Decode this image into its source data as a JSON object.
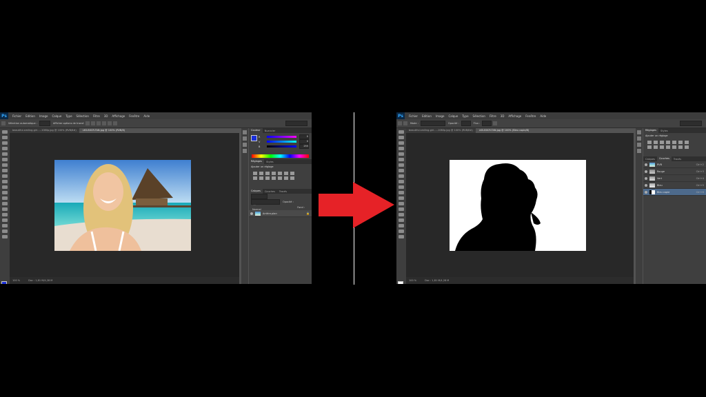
{
  "left_window": {
    "app_logo": "Ps",
    "menu": [
      "Fichier",
      "Edition",
      "Image",
      "Calque",
      "Type",
      "Sélection",
      "Filtre",
      "3D",
      "Affichage",
      "Fenêtre",
      "Aide"
    ],
    "options": {
      "label1": "Sélection automatique :",
      "label2": "Calque",
      "label3": "Afficher options de transf.",
      "workspace": "Essentiel"
    },
    "tabs": [
      "beautiful-smiling-girl-...-1080p.jpg @ 100% (RVB/8#)",
      "LKS-B0CR-TAN.jpg @ 100% (RVB/8)"
    ],
    "status": {
      "zoom": "100 %",
      "doc": "Doc : 1,81 M/4,28 M"
    },
    "color_panel": {
      "tabs": [
        "Couleur",
        "Nuancier"
      ],
      "channels": [
        {
          "label": "R",
          "value": "0"
        },
        {
          "label": "V",
          "value": "0"
        },
        {
          "label": "B",
          "value": "255"
        }
      ]
    },
    "adjustments_panel": {
      "tabs": [
        "Réglages",
        "Styles"
      ],
      "title": "Ajouter un réglage"
    },
    "layers_panel": {
      "tabs": [
        "Calques",
        "Couches",
        "Tracés"
      ],
      "filter": "Type",
      "blend": "Normal",
      "opacity_label": "Opacité :",
      "fill_label": "Fond :",
      "layers": [
        {
          "name": "Arrière-plan",
          "value": ""
        }
      ]
    }
  },
  "arrow_color": "#e62227",
  "right_window": {
    "app_logo": "Ps",
    "menu": [
      "Fichier",
      "Edition",
      "Image",
      "Calque",
      "Type",
      "Sélection",
      "Filtre",
      "3D",
      "Affichage",
      "Fenêtre",
      "Aide"
    ],
    "options": {
      "mode_label": "Mode :",
      "mode_value": "Normal",
      "opacity_label": "Opacité :",
      "opacity_value": "100%",
      "flow_label": "Flux :",
      "flow_value": "100%",
      "workspace": "Essentiel"
    },
    "tabs": [
      "beautiful-smiling-girl-...-1080p.jpg @ 100% (RVB/8#)",
      "LKS-B0CR-TAN.jpg @ 100% (Bleu copie/8)"
    ],
    "status": {
      "zoom": "100 %",
      "doc": "Doc : 1,81 M/4,28 M"
    },
    "adjustments_panel": {
      "tabs": [
        "Réglages",
        "Styles"
      ],
      "title": "Ajouter un réglage"
    },
    "channels_panel": {
      "tabs": [
        "Calques",
        "Couches",
        "Tracés"
      ],
      "channels": [
        {
          "name": "RVB",
          "shortcut": "Ctrl+2"
        },
        {
          "name": "Rouge",
          "shortcut": "Ctrl+3"
        },
        {
          "name": "Vert",
          "shortcut": "Ctrl+4"
        },
        {
          "name": "Bleu",
          "shortcut": "Ctrl+5"
        },
        {
          "name": "Bleu copie",
          "shortcut": "Ctrl+6"
        }
      ]
    }
  }
}
